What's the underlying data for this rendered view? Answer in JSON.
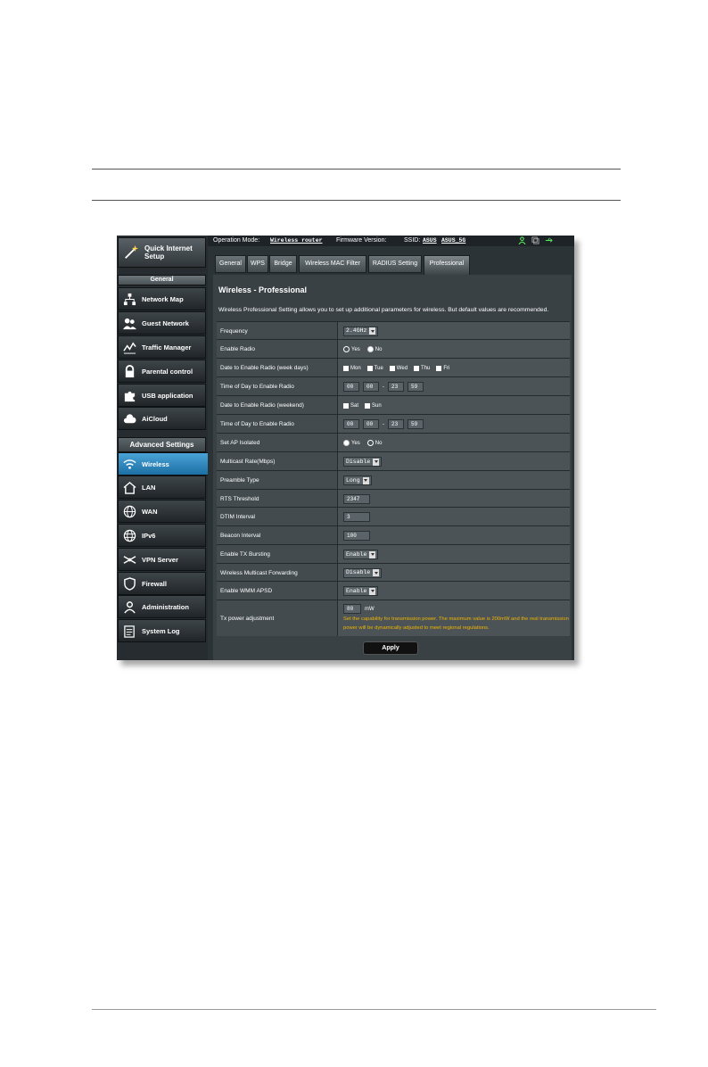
{
  "sidebar": {
    "qis": "Quick Internet Setup",
    "general_header": "General",
    "general_items": [
      {
        "label": "Network Map",
        "icon": "network-map-icon"
      },
      {
        "label": "Guest Network",
        "icon": "guest-network-icon"
      },
      {
        "label": "Traffic Manager",
        "icon": "traffic-manager-icon"
      },
      {
        "label": "Parental control",
        "icon": "lock-icon"
      },
      {
        "label": "USB application",
        "icon": "puzzle-icon"
      },
      {
        "label": "AiCloud",
        "icon": "cloud-icon"
      }
    ],
    "advanced_header": "Advanced Settings",
    "advanced_items": [
      {
        "label": "Wireless",
        "icon": "wifi-icon",
        "active": true
      },
      {
        "label": "LAN",
        "icon": "home-icon"
      },
      {
        "label": "WAN",
        "icon": "globe-icon"
      },
      {
        "label": "IPv6",
        "icon": "ipv6-globe-icon"
      },
      {
        "label": "VPN Server",
        "icon": "vpn-icon"
      },
      {
        "label": "Firewall",
        "icon": "shield-icon"
      },
      {
        "label": "Administration",
        "icon": "user-icon"
      },
      {
        "label": "System Log",
        "icon": "log-icon"
      }
    ]
  },
  "topbar": {
    "operation_label": "Operation Mode:",
    "operation_value": "Wireless router",
    "firmware_label": "Firmware Version:",
    "ssid_label": "SSID:",
    "ssid_1": "ASUS",
    "ssid_2": "ASUS_5G"
  },
  "tabs": [
    "General",
    "WPS",
    "Bridge",
    "Wireless MAC Filter",
    "RADIUS Setting",
    "Professional"
  ],
  "panel": {
    "title": "Wireless - Professional",
    "description": "Wireless Professional Setting allows you to set up additional parameters for wireless. But default values are recommended."
  },
  "rows": {
    "frequency": {
      "label": "Frequency",
      "value": "2.4GHz"
    },
    "enable_radio": {
      "label": "Enable Radio",
      "yes": "Yes",
      "no": "No"
    },
    "date_weekdays": {
      "label": "Date to Enable Radio (week days)",
      "days": [
        "Mon",
        "Tue",
        "Wed",
        "Thu",
        "Fri"
      ]
    },
    "time_weekdays": {
      "label": "Time of Day to Enable Radio",
      "h1": "00",
      "m1": "00",
      "sep": "-",
      "h2": "23",
      "m2": "59"
    },
    "date_weekend": {
      "label": "Date to Enable Radio (weekend)",
      "days": [
        "Sat",
        "Sun"
      ]
    },
    "time_weekend": {
      "label": "Time of Day to Enable Radio",
      "h1": "00",
      "m1": "00",
      "sep": "-",
      "h2": "23",
      "m2": "59"
    },
    "ap_isolated": {
      "label": "Set AP Isolated",
      "yes": "Yes",
      "no": "No"
    },
    "multicast_rate": {
      "label": "Multicast Rate(Mbps)",
      "value": "Disable"
    },
    "preamble": {
      "label": "Preamble Type",
      "value": "Long"
    },
    "rts": {
      "label": "RTS Threshold",
      "value": "2347"
    },
    "dtim": {
      "label": "DTIM Interval",
      "value": "3"
    },
    "beacon": {
      "label": "Beacon Interval",
      "value": "100"
    },
    "tx_bursting": {
      "label": "Enable TX Bursting",
      "value": "Enable"
    },
    "multicast_fwd": {
      "label": "Wireless Multicast Forwarding",
      "value": "Disable"
    },
    "wmm_apsd": {
      "label": "Enable WMM APSD",
      "value": "Enable"
    },
    "tx_power": {
      "label": "Tx power adjustment",
      "value": "80",
      "unit": "mW",
      "warning": "Set the capability for transmission power. The maximum value is 200mW and the real transmission power will be dynamically adjusted to meet regional regulations."
    }
  },
  "apply_label": "Apply"
}
